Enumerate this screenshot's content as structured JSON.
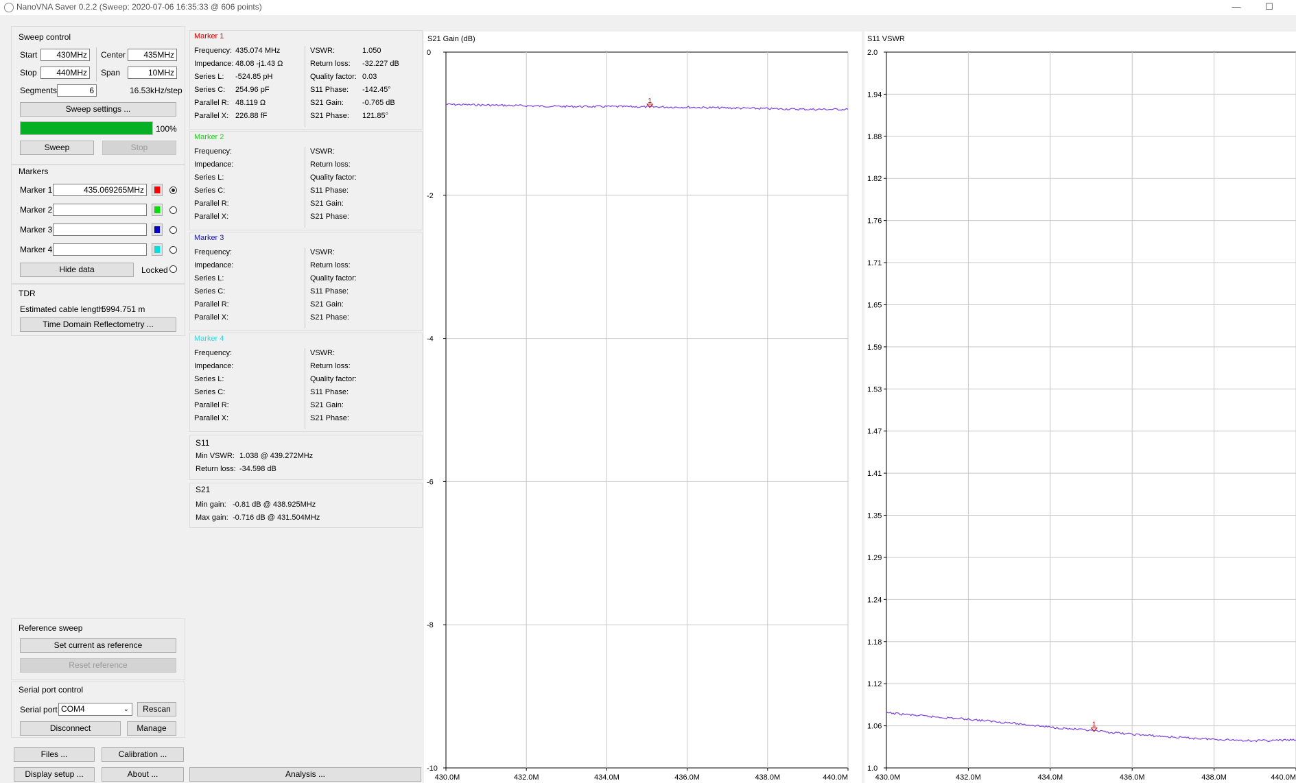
{
  "window": {
    "title": "NanoVNA Saver 0.2.2 (Sweep: 2020-07-06 16:35:33 @ 606 points)",
    "minimize": "—",
    "maximize": "☐"
  },
  "sweep_control": {
    "title": "Sweep control",
    "start_label": "Start",
    "start_value": "430MHz",
    "center_label": "Center",
    "center_value": "435MHz",
    "stop_label": "Stop",
    "stop_value": "440MHz",
    "span_label": "Span",
    "span_value": "10MHz",
    "segments_label": "Segments",
    "segments_value": "6",
    "step_text": "16.53kHz/step",
    "settings_button": "Sweep settings ...",
    "progress_percent": 100,
    "progress_text": "100%",
    "sweep_button": "Sweep",
    "stop_button": "Stop"
  },
  "markers": {
    "title": "Markers",
    "items": [
      {
        "label": "Marker 1",
        "value": "435.069265MHz",
        "color": "#ff0000",
        "selected": true
      },
      {
        "label": "Marker 2",
        "value": "",
        "color": "#00e000",
        "selected": false
      },
      {
        "label": "Marker 3",
        "value": "",
        "color": "#0000c8",
        "selected": false
      },
      {
        "label": "Marker 4",
        "value": "",
        "color": "#00e0e0",
        "selected": false
      }
    ],
    "hide_button": "Hide data",
    "locked_label": "Locked"
  },
  "tdr": {
    "title": "TDR",
    "cable_label": "Estimated cable length:",
    "cable_value": "5994.751 m",
    "button": "Time Domain Reflectometry ..."
  },
  "reference": {
    "title": "Reference sweep",
    "set_button": "Set current as reference",
    "reset_button": "Reset reference"
  },
  "serial": {
    "title": "Serial port control",
    "port_label": "Serial port",
    "port_value": "COM4",
    "rescan_button": "Rescan",
    "disconnect_button": "Disconnect",
    "manage_button": "Manage"
  },
  "bottom_buttons": {
    "files": "Files ...",
    "calibration": "Calibration ...",
    "display": "Display setup ...",
    "about": "About ...",
    "analysis": "Analysis ..."
  },
  "marker_panels": [
    {
      "title": "Marker 1",
      "color": "#d00000",
      "left": [
        [
          "Frequency:",
          "435.074 MHz"
        ],
        [
          "Impedance:",
          "48.08 -j1.43 Ω"
        ],
        [
          "Series L:",
          "-524.85 pH"
        ],
        [
          "Series C:",
          "254.96 pF"
        ],
        [
          "Parallel R:",
          "48.119 Ω"
        ],
        [
          "Parallel X:",
          "226.88 fF"
        ]
      ],
      "right": [
        [
          "VSWR:",
          "1.050"
        ],
        [
          "Return loss:",
          "-32.227 dB"
        ],
        [
          "Quality factor:",
          "0.03"
        ],
        [
          "S11 Phase:",
          "-142.45°"
        ],
        [
          "S21 Gain:",
          "-0.765 dB"
        ],
        [
          "S21 Phase:",
          "121.85°"
        ]
      ]
    },
    {
      "title": "Marker 2",
      "color": "#20d020",
      "left": [
        [
          "Frequency:",
          ""
        ],
        [
          "Impedance:",
          ""
        ],
        [
          "Series L:",
          ""
        ],
        [
          "Series C:",
          ""
        ],
        [
          "Parallel R:",
          ""
        ],
        [
          "Parallel X:",
          ""
        ]
      ],
      "right": [
        [
          "VSWR:",
          ""
        ],
        [
          "Return loss:",
          ""
        ],
        [
          "Quality factor:",
          ""
        ],
        [
          "S11 Phase:",
          ""
        ],
        [
          "S21 Gain:",
          ""
        ],
        [
          "S21 Phase:",
          ""
        ]
      ]
    },
    {
      "title": "Marker 3",
      "color": "#1818b0",
      "left": [
        [
          "Frequency:",
          ""
        ],
        [
          "Impedance:",
          ""
        ],
        [
          "Series L:",
          ""
        ],
        [
          "Series C:",
          ""
        ],
        [
          "Parallel R:",
          ""
        ],
        [
          "Parallel X:",
          ""
        ]
      ],
      "right": [
        [
          "VSWR:",
          ""
        ],
        [
          "Return loss:",
          ""
        ],
        [
          "Quality factor:",
          ""
        ],
        [
          "S11 Phase:",
          ""
        ],
        [
          "S21 Gain:",
          ""
        ],
        [
          "S21 Phase:",
          ""
        ]
      ]
    },
    {
      "title": "Marker 4",
      "color": "#30d8e0",
      "left": [
        [
          "Frequency:",
          ""
        ],
        [
          "Impedance:",
          ""
        ],
        [
          "Series L:",
          ""
        ],
        [
          "Series C:",
          ""
        ],
        [
          "Parallel R:",
          ""
        ],
        [
          "Parallel X:",
          ""
        ]
      ],
      "right": [
        [
          "VSWR:",
          ""
        ],
        [
          "Return loss:",
          ""
        ],
        [
          "Quality factor:",
          ""
        ],
        [
          "S11 Phase:",
          ""
        ],
        [
          "S21 Gain:",
          ""
        ],
        [
          "S21 Phase:",
          ""
        ]
      ]
    }
  ],
  "s11_summary": {
    "title": "S11",
    "min_vswr_label": "Min VSWR:",
    "min_vswr_value": "1.038 @ 439.272MHz",
    "return_loss_label": "Return loss:",
    "return_loss_value": "-34.598 dB"
  },
  "s21_summary": {
    "title": "S21",
    "min_gain_label": "Min gain:",
    "min_gain_value": "-0.81 dB @ 438.925MHz",
    "max_gain_label": "Max gain:",
    "max_gain_value": "-0.716 dB @ 431.504MHz"
  },
  "chart_data": [
    {
      "type": "line",
      "title": "S21 Gain (dB)",
      "xlim": [
        430.0,
        440.0
      ],
      "ylim": [
        -10,
        0
      ],
      "x_ticks": [
        "430.0M",
        "432.0M",
        "434.0M",
        "436.0M",
        "438.0M",
        "440.0M"
      ],
      "y_ticks": [
        "0",
        "-2",
        "-4",
        "-6",
        "-8",
        "-10"
      ],
      "series": [
        {
          "color": "#7b3fe8",
          "x": [
            430.0,
            431.0,
            432.0,
            433.0,
            434.0,
            435.0,
            436.0,
            437.0,
            438.0,
            439.0,
            440.0
          ],
          "y": [
            -0.73,
            -0.74,
            -0.75,
            -0.76,
            -0.76,
            -0.765,
            -0.77,
            -0.78,
            -0.79,
            -0.8,
            -0.8
          ]
        }
      ],
      "marker": {
        "label": "1",
        "x": 435.07,
        "y": -0.765,
        "color": "#d00000"
      },
      "grid": true
    },
    {
      "type": "line",
      "title": "S11 VSWR",
      "xlim": [
        430.0,
        440.0
      ],
      "ylim": [
        1.0,
        2.0
      ],
      "x_ticks": [
        "430.0M",
        "432.0M",
        "434.0M",
        "436.0M",
        "438.0M",
        "440.0M"
      ],
      "y_ticks": [
        "2.0",
        "1.94",
        "1.88",
        "1.82",
        "1.76",
        "1.71",
        "1.65",
        "1.59",
        "1.53",
        "1.47",
        "1.41",
        "1.35",
        "1.29",
        "1.24",
        "1.18",
        "1.12",
        "1.06",
        "1.0"
      ],
      "series": [
        {
          "color": "#7b3fe8",
          "x": [
            430.0,
            431.0,
            432.0,
            433.0,
            434.0,
            435.0,
            436.0,
            437.0,
            438.0,
            439.0,
            440.0
          ],
          "y": [
            1.077,
            1.072,
            1.068,
            1.063,
            1.057,
            1.052,
            1.047,
            1.043,
            1.04,
            1.038,
            1.039
          ]
        }
      ],
      "marker": {
        "label": "1",
        "x": 435.07,
        "y": 1.052,
        "color": "#d00000"
      },
      "grid": true
    }
  ]
}
